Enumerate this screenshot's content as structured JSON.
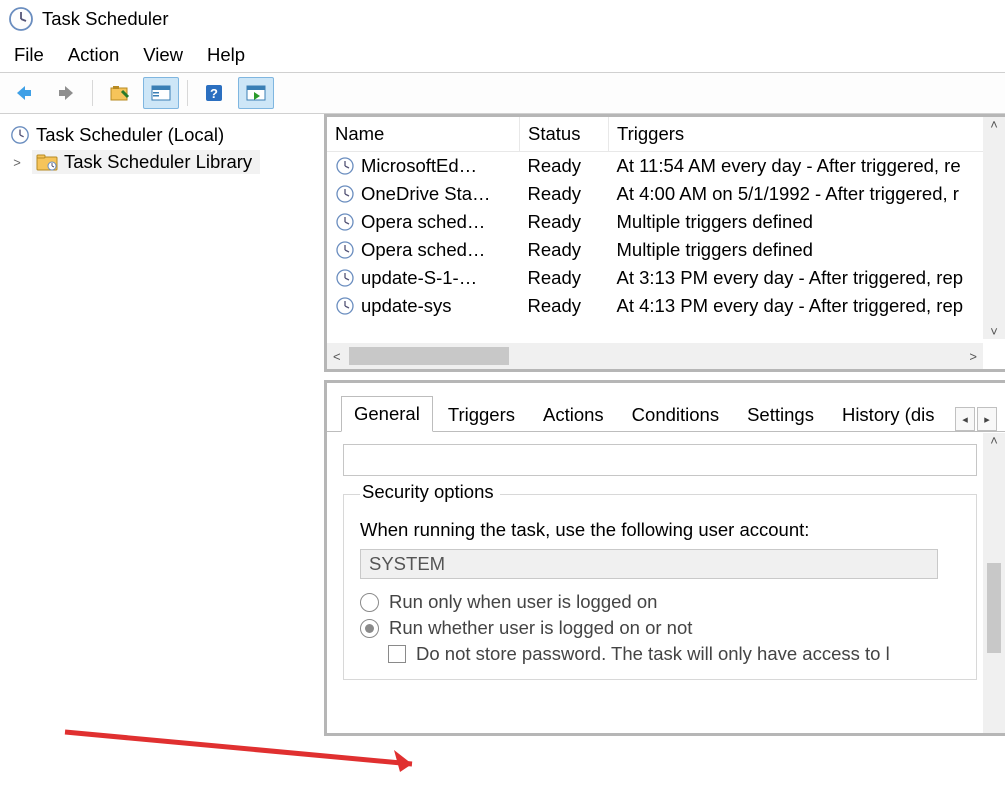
{
  "window": {
    "title": "Task Scheduler"
  },
  "menu": {
    "file": "File",
    "action": "Action",
    "view": "View",
    "help": "Help"
  },
  "tree": {
    "root": "Task Scheduler (Local)",
    "library": "Task Scheduler Library"
  },
  "columns": {
    "name": "Name",
    "status": "Status",
    "triggers": "Triggers"
  },
  "tasks": [
    {
      "name": "MicrosoftEd…",
      "status": "Ready",
      "trigger": "At 11:54 AM every day - After triggered, re"
    },
    {
      "name": "OneDrive Sta…",
      "status": "Ready",
      "trigger": "At 4:00 AM on 5/1/1992 - After triggered, r"
    },
    {
      "name": "Opera sched…",
      "status": "Ready",
      "trigger": "Multiple triggers defined"
    },
    {
      "name": "Opera sched…",
      "status": "Ready",
      "trigger": "Multiple triggers defined"
    },
    {
      "name": "update-S-1-…",
      "status": "Ready",
      "trigger": "At 3:13 PM every day - After triggered, rep"
    },
    {
      "name": "update-sys",
      "status": "Ready",
      "trigger": "At 4:13 PM every day - After triggered, rep"
    }
  ],
  "tabs": {
    "general": "General",
    "triggers": "Triggers",
    "actions": "Actions",
    "conditions": "Conditions",
    "settings": "Settings",
    "history": "History (dis"
  },
  "security": {
    "legend": "Security options",
    "prompt": "When running the task, use the following user account:",
    "account": "SYSTEM",
    "radio_logged_on": "Run only when user is logged on",
    "radio_logged_off": "Run whether user is logged on or not",
    "check_nopass": "Do not store password.  The task will only have access to l"
  }
}
